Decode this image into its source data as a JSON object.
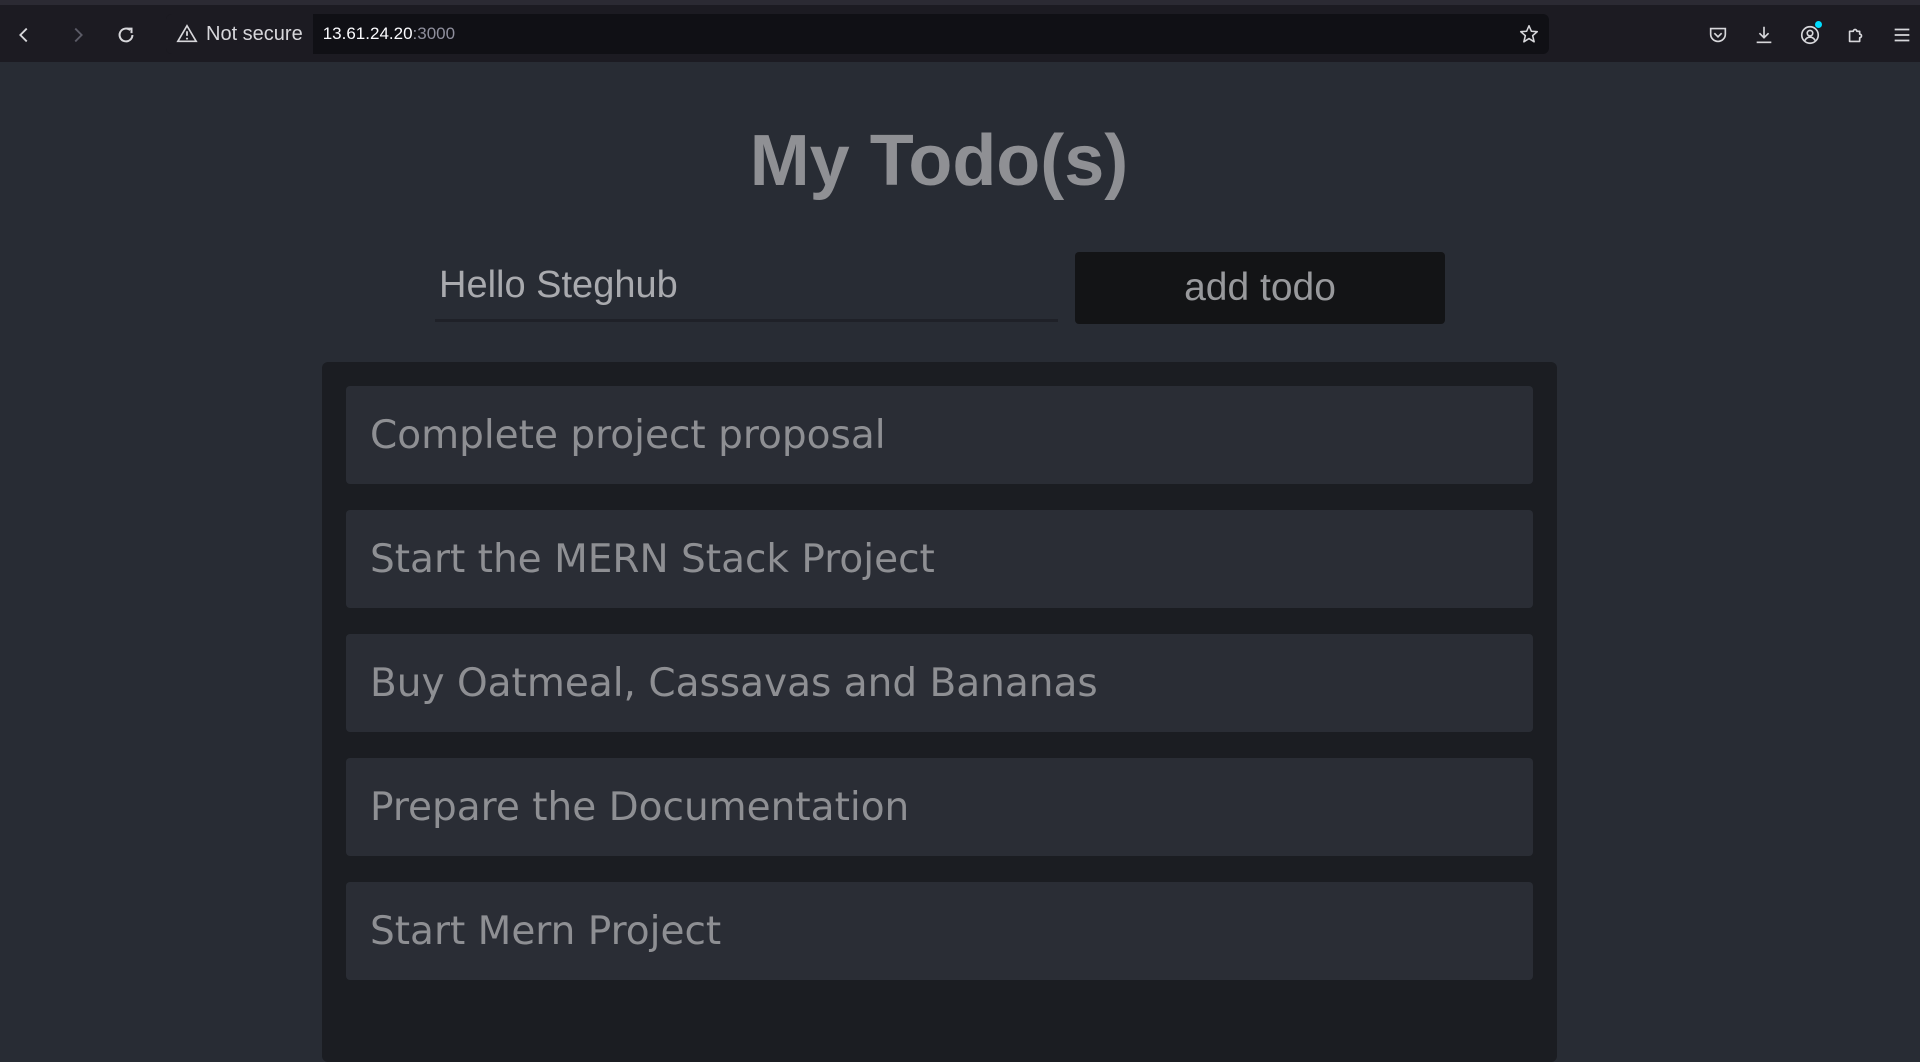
{
  "browser": {
    "security_label": "Not secure",
    "url_host": "13.61.24.20",
    "url_port": ":3000",
    "icons": [
      "back-icon",
      "forward-icon",
      "reload-icon",
      "warning-icon",
      "bookmark-star-icon",
      "pocket-icon",
      "download-icon",
      "account-icon",
      "extensions-icon",
      "menu-icon"
    ]
  },
  "app": {
    "title": "My Todo(s)",
    "input_value": "Hello Steghub",
    "add_button_label": "add todo",
    "todos": [
      "Complete project proposal",
      "Start the MERN Stack Project",
      "Buy Oatmeal, Cassavas and Bananas",
      "Prepare the Documentation",
      "Start Mern Project"
    ]
  }
}
